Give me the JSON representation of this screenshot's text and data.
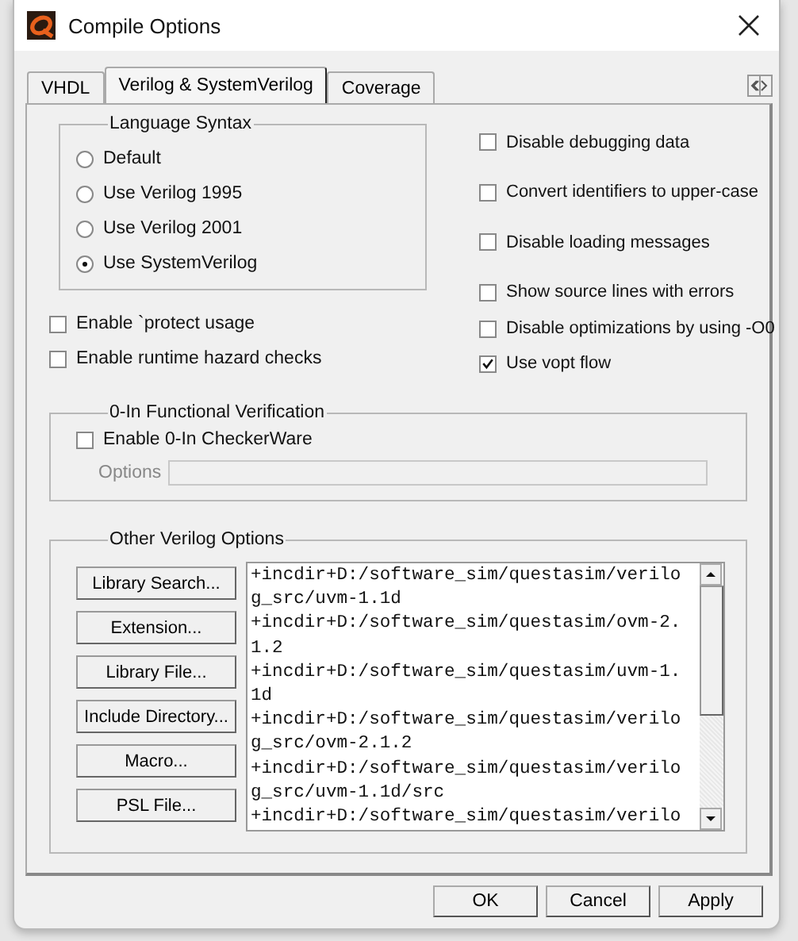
{
  "window": {
    "title": "Compile Options"
  },
  "tabs": [
    {
      "label": "VHDL",
      "selected": false
    },
    {
      "label": "Verilog & SystemVerilog",
      "selected": true
    },
    {
      "label": "Coverage",
      "selected": false
    }
  ],
  "language_syntax": {
    "title": "Language Syntax",
    "options": [
      {
        "label": "Default",
        "selected": false
      },
      {
        "label": "Use Verilog 1995",
        "selected": false
      },
      {
        "label": "Use Verilog 2001",
        "selected": false
      },
      {
        "label": "Use SystemVerilog",
        "selected": true
      }
    ]
  },
  "left_checks": [
    {
      "label": "Enable `protect usage",
      "checked": false
    },
    {
      "label": "Enable runtime hazard checks",
      "checked": false
    }
  ],
  "right_checks": [
    {
      "label": "Disable debugging data",
      "checked": false
    },
    {
      "label": "Convert identifiers to upper-case",
      "checked": false
    },
    {
      "label": "Disable loading messages",
      "checked": false
    },
    {
      "label": "Show source lines with errors",
      "checked": false
    },
    {
      "label": "Disable optimizations by using -O0",
      "checked": false
    },
    {
      "label": "Use vopt flow",
      "checked": true
    }
  ],
  "functional_verification": {
    "title": "0-In Functional Verification",
    "enable": {
      "label": "Enable 0-In CheckerWare",
      "checked": false
    },
    "options_label": "Options",
    "disabled": true
  },
  "other_options": {
    "title": "Other Verilog Options",
    "buttons": [
      "Library Search...",
      "Extension...",
      "Library File...",
      "Include Directory...",
      "Macro...",
      "PSL File..."
    ],
    "text_lines": [
      "+incdir+D:/software_sim/questasim/verilo",
      "g_src/uvm-1.1d",
      "+incdir+D:/software_sim/questasim/ovm-2.",
      "1.2",
      "+incdir+D:/software_sim/questasim/uvm-1.",
      "1d",
      "+incdir+D:/software_sim/questasim/verilo",
      "g_src/ovm-2.1.2",
      "+incdir+D:/software_sim/questasim/verilo",
      "g_src/uvm-1.1d/src",
      "+incdir+D:/software_sim/questasim/verilo"
    ]
  },
  "buttons": [
    "OK",
    "Cancel",
    "Apply"
  ]
}
